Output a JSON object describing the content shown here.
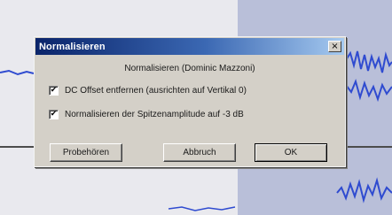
{
  "dialog": {
    "title": "Normalisieren",
    "close_glyph": "×",
    "subtitle": "Normalisieren (Dominic Mazzoni)",
    "options": [
      {
        "label": "DC Offset entfernen (ausrichten auf Vertikal 0)",
        "checked": true
      },
      {
        "label": "Normalisieren der Spitzenamplitude auf -3 dB",
        "checked": true
      }
    ],
    "buttons": {
      "preview": "Probehören",
      "cancel": "Abbruch",
      "ok": "OK"
    }
  },
  "colors": {
    "waveform": "#2f4bd0",
    "selection": "#b9bfd9",
    "title_gradient_start": "#0a246a"
  },
  "icons": {
    "close": "close-icon",
    "check": "check-icon"
  }
}
